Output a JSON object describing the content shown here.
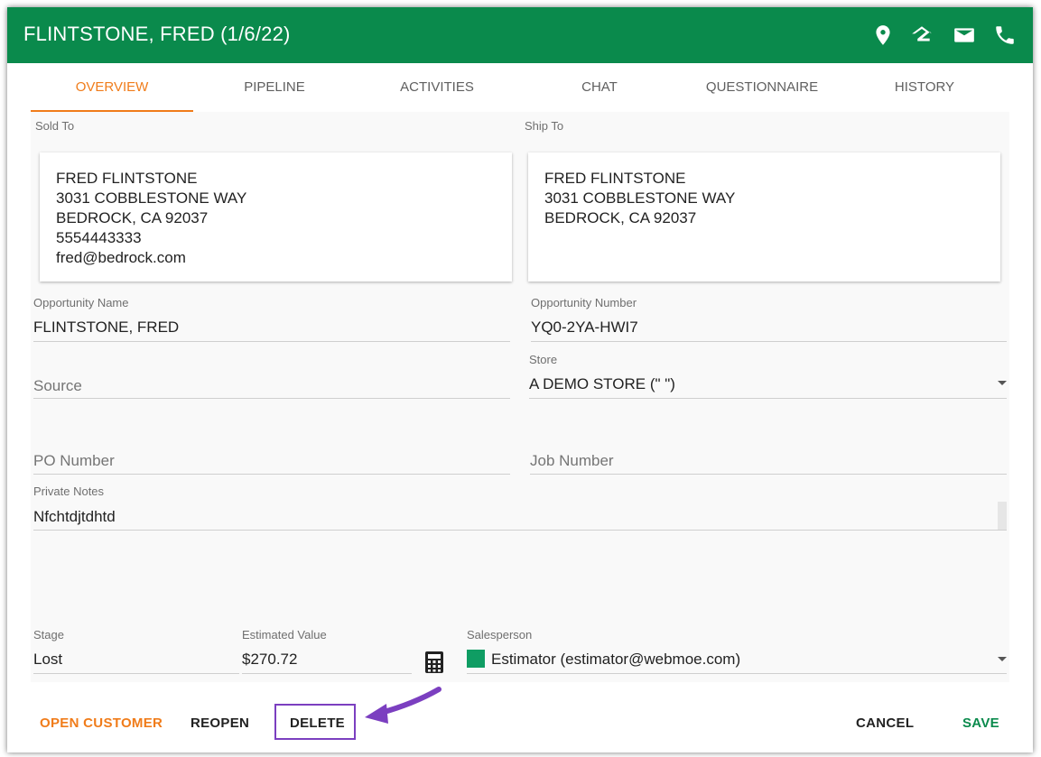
{
  "header": {
    "title": "FLINTSTONE, FRED (1/6/22)",
    "bg_color": "#0a8a4c",
    "icons": [
      "map-pin-icon",
      "zillow-icon",
      "mail-icon",
      "phone-icon"
    ]
  },
  "tabs": [
    {
      "label": "OVERVIEW",
      "active": true
    },
    {
      "label": "PIPELINE",
      "active": false
    },
    {
      "label": "ACTIVITIES",
      "active": false
    },
    {
      "label": "CHAT",
      "active": false
    },
    {
      "label": "QUESTIONNAIRE",
      "active": false
    },
    {
      "label": "HISTORY",
      "active": false
    }
  ],
  "accent_color": "#f07c1a",
  "sold_to": {
    "label": "Sold To",
    "lines": [
      "FRED FLINTSTONE",
      "3031 COBBLESTONE WAY",
      "BEDROCK, CA 92037",
      "5554443333",
      "fred@bedrock.com"
    ]
  },
  "ship_to": {
    "label": "Ship To",
    "lines": [
      "FRED FLINTSTONE",
      "3031 COBBLESTONE WAY",
      "BEDROCK, CA 92037"
    ]
  },
  "fields": {
    "opportunity_name": {
      "label": "Opportunity Name",
      "value": "FLINTSTONE, FRED"
    },
    "opportunity_number": {
      "label": "Opportunity Number",
      "value": "YQ0-2YA-HWI7"
    },
    "source": {
      "placeholder": "Source"
    },
    "store": {
      "label": "Store",
      "value": "A DEMO STORE (\" \")"
    },
    "po_number": {
      "placeholder": "PO Number"
    },
    "job_number": {
      "placeholder": "Job Number"
    },
    "private_notes": {
      "label": "Private Notes",
      "value": "Nfchtdjtdhtd"
    },
    "stage": {
      "label": "Stage",
      "value": "Lost"
    },
    "estimated_value": {
      "label": "Estimated Value",
      "value": "$270.72"
    },
    "salesperson": {
      "label": "Salesperson",
      "value": "Estimator (estimator@webmoe.com)",
      "swatch_color": "#0f9d63"
    }
  },
  "footer": {
    "open_customer": "OPEN CUSTOMER",
    "reopen": "REOPEN",
    "delete": "DELETE",
    "cancel": "CANCEL",
    "save": "SAVE"
  },
  "annotation_color": "#7b3fc0"
}
